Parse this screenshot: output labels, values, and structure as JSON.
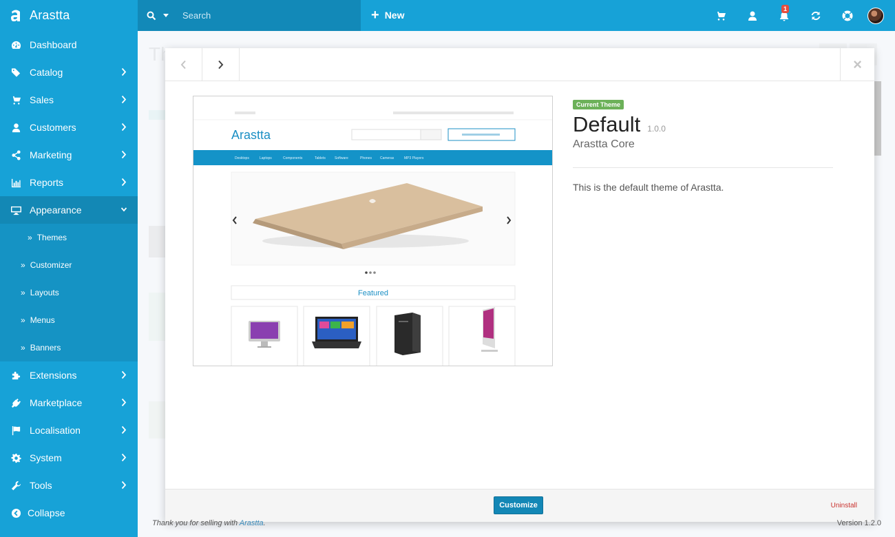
{
  "brand": {
    "name": "Arastta"
  },
  "sidebar": {
    "items": [
      {
        "label": "Dashboard",
        "icon": "dashboard-icon",
        "chevron": false
      },
      {
        "label": "Catalog",
        "icon": "tags-icon",
        "chevron": true
      },
      {
        "label": "Sales",
        "icon": "cart-icon",
        "chevron": true
      },
      {
        "label": "Customers",
        "icon": "user-icon",
        "chevron": true
      },
      {
        "label": "Marketing",
        "icon": "share-icon",
        "chevron": true
      },
      {
        "label": "Reports",
        "icon": "bar-chart-icon",
        "chevron": true
      },
      {
        "label": "Appearance",
        "icon": "desktop-icon",
        "chevron": true,
        "expanded": true
      },
      {
        "label": "Extensions",
        "icon": "puzzle-icon",
        "chevron": true
      },
      {
        "label": "Marketplace",
        "icon": "plug-icon",
        "chevron": true
      },
      {
        "label": "Localisation",
        "icon": "flag-icon",
        "chevron": true
      },
      {
        "label": "System",
        "icon": "gear-icon",
        "chevron": true
      },
      {
        "label": "Tools",
        "icon": "wrench-icon",
        "chevron": true
      },
      {
        "label": "Collapse",
        "icon": "circle-left-icon",
        "chevron": false
      }
    ],
    "appearance_sub": [
      {
        "label": "Themes",
        "current": true
      },
      {
        "label": "Customizer"
      },
      {
        "label": "Layouts"
      },
      {
        "label": "Menus"
      },
      {
        "label": "Banners"
      }
    ]
  },
  "topbar": {
    "search_placeholder": "Search",
    "new_label": "New",
    "notification_count": "1"
  },
  "modal": {
    "badge": "Current Theme",
    "theme_name": "Default",
    "version": "1.0.0",
    "author": "Arastta Core",
    "description": "This is the default theme of Arastta.",
    "customize_label": "Customize",
    "uninstall_label": "Uninstall",
    "close_symbol": "×"
  },
  "preview": {
    "logo": "Arastta",
    "menu": [
      "Desktops",
      "Laptops",
      "Components",
      "Tablets",
      "Software",
      "Phones",
      "Cameras",
      "MP3 Players"
    ],
    "featured": "Featured"
  },
  "footer": {
    "thanks_prefix": "Thank you for selling with ",
    "thanks_link": "Arastta",
    "thanks_suffix": ".",
    "version": "Version 1.2.0"
  },
  "colors": {
    "sidebar": "#17a2d7",
    "sidebar_active": "#1388b5",
    "search_bg": "#1289b8",
    "badge_green": "#6cb159",
    "primary_btn": "#1387b6",
    "danger": "#c9302c"
  }
}
